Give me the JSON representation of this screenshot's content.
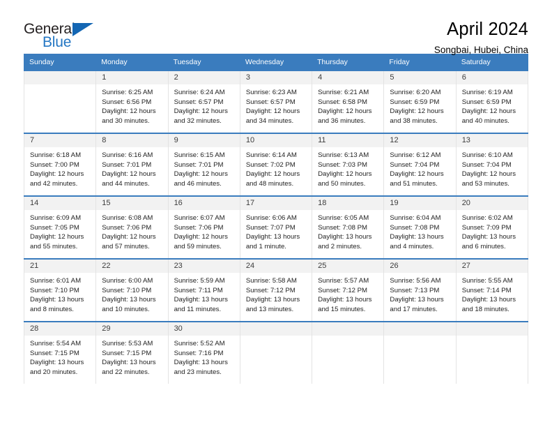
{
  "brand": {
    "name_part1": "General",
    "name_part2": "Blue",
    "triangle_color": "#1466b3",
    "blue_color": "#2376c3"
  },
  "header": {
    "title": "April 2024",
    "location": "Songbai, Hubei, China"
  },
  "theme": {
    "header_bg": "#3a7cbe",
    "header_text": "#ffffff",
    "daynum_bg": "#f2f2f2",
    "cell_border": "#e3e3e3",
    "row_top_border": "#3a7cbe"
  },
  "calendar": {
    "weekdays": [
      "Sunday",
      "Monday",
      "Tuesday",
      "Wednesday",
      "Thursday",
      "Friday",
      "Saturday"
    ],
    "weeks": [
      [
        {
          "day": "",
          "lines": []
        },
        {
          "day": "1",
          "lines": [
            "Sunrise: 6:25 AM",
            "Sunset: 6:56 PM",
            "Daylight: 12 hours",
            "and 30 minutes."
          ]
        },
        {
          "day": "2",
          "lines": [
            "Sunrise: 6:24 AM",
            "Sunset: 6:57 PM",
            "Daylight: 12 hours",
            "and 32 minutes."
          ]
        },
        {
          "day": "3",
          "lines": [
            "Sunrise: 6:23 AM",
            "Sunset: 6:57 PM",
            "Daylight: 12 hours",
            "and 34 minutes."
          ]
        },
        {
          "day": "4",
          "lines": [
            "Sunrise: 6:21 AM",
            "Sunset: 6:58 PM",
            "Daylight: 12 hours",
            "and 36 minutes."
          ]
        },
        {
          "day": "5",
          "lines": [
            "Sunrise: 6:20 AM",
            "Sunset: 6:59 PM",
            "Daylight: 12 hours",
            "and 38 minutes."
          ]
        },
        {
          "day": "6",
          "lines": [
            "Sunrise: 6:19 AM",
            "Sunset: 6:59 PM",
            "Daylight: 12 hours",
            "and 40 minutes."
          ]
        }
      ],
      [
        {
          "day": "7",
          "lines": [
            "Sunrise: 6:18 AM",
            "Sunset: 7:00 PM",
            "Daylight: 12 hours",
            "and 42 minutes."
          ]
        },
        {
          "day": "8",
          "lines": [
            "Sunrise: 6:16 AM",
            "Sunset: 7:01 PM",
            "Daylight: 12 hours",
            "and 44 minutes."
          ]
        },
        {
          "day": "9",
          "lines": [
            "Sunrise: 6:15 AM",
            "Sunset: 7:01 PM",
            "Daylight: 12 hours",
            "and 46 minutes."
          ]
        },
        {
          "day": "10",
          "lines": [
            "Sunrise: 6:14 AM",
            "Sunset: 7:02 PM",
            "Daylight: 12 hours",
            "and 48 minutes."
          ]
        },
        {
          "day": "11",
          "lines": [
            "Sunrise: 6:13 AM",
            "Sunset: 7:03 PM",
            "Daylight: 12 hours",
            "and 50 minutes."
          ]
        },
        {
          "day": "12",
          "lines": [
            "Sunrise: 6:12 AM",
            "Sunset: 7:04 PM",
            "Daylight: 12 hours",
            "and 51 minutes."
          ]
        },
        {
          "day": "13",
          "lines": [
            "Sunrise: 6:10 AM",
            "Sunset: 7:04 PM",
            "Daylight: 12 hours",
            "and 53 minutes."
          ]
        }
      ],
      [
        {
          "day": "14",
          "lines": [
            "Sunrise: 6:09 AM",
            "Sunset: 7:05 PM",
            "Daylight: 12 hours",
            "and 55 minutes."
          ]
        },
        {
          "day": "15",
          "lines": [
            "Sunrise: 6:08 AM",
            "Sunset: 7:06 PM",
            "Daylight: 12 hours",
            "and 57 minutes."
          ]
        },
        {
          "day": "16",
          "lines": [
            "Sunrise: 6:07 AM",
            "Sunset: 7:06 PM",
            "Daylight: 12 hours",
            "and 59 minutes."
          ]
        },
        {
          "day": "17",
          "lines": [
            "Sunrise: 6:06 AM",
            "Sunset: 7:07 PM",
            "Daylight: 13 hours",
            "and 1 minute."
          ]
        },
        {
          "day": "18",
          "lines": [
            "Sunrise: 6:05 AM",
            "Sunset: 7:08 PM",
            "Daylight: 13 hours",
            "and 2 minutes."
          ]
        },
        {
          "day": "19",
          "lines": [
            "Sunrise: 6:04 AM",
            "Sunset: 7:08 PM",
            "Daylight: 13 hours",
            "and 4 minutes."
          ]
        },
        {
          "day": "20",
          "lines": [
            "Sunrise: 6:02 AM",
            "Sunset: 7:09 PM",
            "Daylight: 13 hours",
            "and 6 minutes."
          ]
        }
      ],
      [
        {
          "day": "21",
          "lines": [
            "Sunrise: 6:01 AM",
            "Sunset: 7:10 PM",
            "Daylight: 13 hours",
            "and 8 minutes."
          ]
        },
        {
          "day": "22",
          "lines": [
            "Sunrise: 6:00 AM",
            "Sunset: 7:10 PM",
            "Daylight: 13 hours",
            "and 10 minutes."
          ]
        },
        {
          "day": "23",
          "lines": [
            "Sunrise: 5:59 AM",
            "Sunset: 7:11 PM",
            "Daylight: 13 hours",
            "and 11 minutes."
          ]
        },
        {
          "day": "24",
          "lines": [
            "Sunrise: 5:58 AM",
            "Sunset: 7:12 PM",
            "Daylight: 13 hours",
            "and 13 minutes."
          ]
        },
        {
          "day": "25",
          "lines": [
            "Sunrise: 5:57 AM",
            "Sunset: 7:12 PM",
            "Daylight: 13 hours",
            "and 15 minutes."
          ]
        },
        {
          "day": "26",
          "lines": [
            "Sunrise: 5:56 AM",
            "Sunset: 7:13 PM",
            "Daylight: 13 hours",
            "and 17 minutes."
          ]
        },
        {
          "day": "27",
          "lines": [
            "Sunrise: 5:55 AM",
            "Sunset: 7:14 PM",
            "Daylight: 13 hours",
            "and 18 minutes."
          ]
        }
      ],
      [
        {
          "day": "28",
          "lines": [
            "Sunrise: 5:54 AM",
            "Sunset: 7:15 PM",
            "Daylight: 13 hours",
            "and 20 minutes."
          ]
        },
        {
          "day": "29",
          "lines": [
            "Sunrise: 5:53 AM",
            "Sunset: 7:15 PM",
            "Daylight: 13 hours",
            "and 22 minutes."
          ]
        },
        {
          "day": "30",
          "lines": [
            "Sunrise: 5:52 AM",
            "Sunset: 7:16 PM",
            "Daylight: 13 hours",
            "and 23 minutes."
          ]
        },
        {
          "day": "",
          "lines": []
        },
        {
          "day": "",
          "lines": []
        },
        {
          "day": "",
          "lines": []
        },
        {
          "day": "",
          "lines": []
        }
      ]
    ]
  }
}
